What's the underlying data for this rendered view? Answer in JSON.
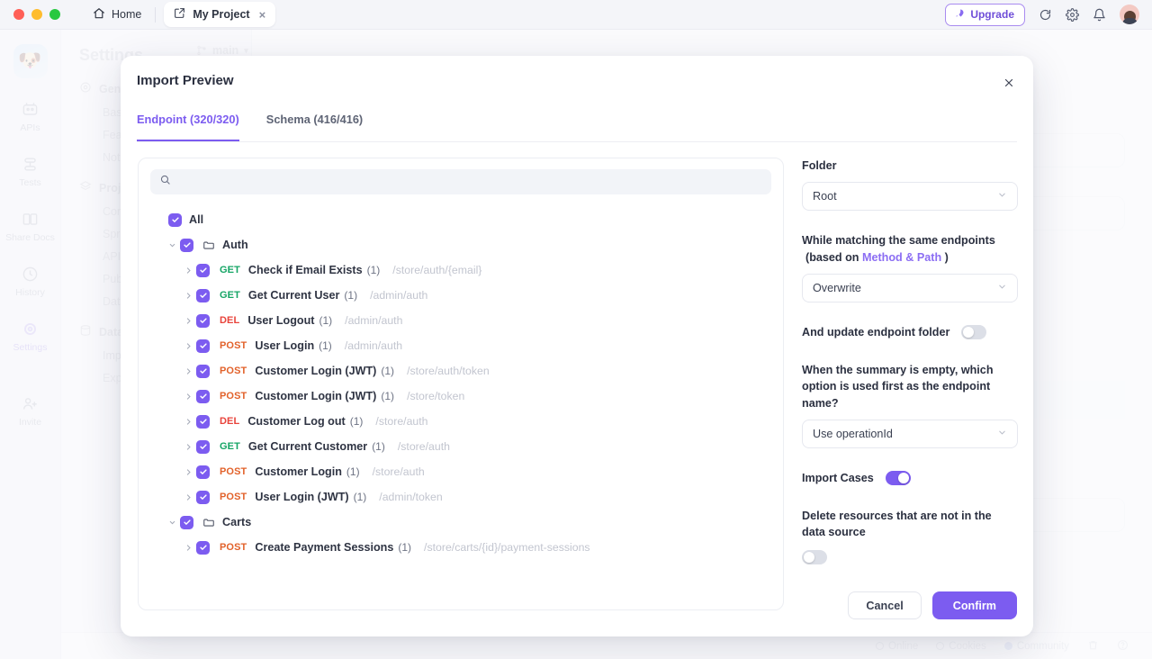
{
  "titlebar": {
    "home_label": "Home",
    "project_tab_label": "My Project",
    "close_tab": "×",
    "upgrade_label": "Upgrade",
    "upgrade_icon": "rocket-icon",
    "refresh_icon": "refresh-icon",
    "settings_icon": "gear-icon",
    "notifications_icon": "bell-icon",
    "avatar_icon": "user-avatar"
  },
  "rail": {
    "logo_glyph": "🐶",
    "items": [
      {
        "label": "APIs",
        "icon": "apis-icon",
        "active": false
      },
      {
        "label": "Tests",
        "icon": "tests-icon",
        "active": false
      },
      {
        "label": "Share Docs",
        "icon": "share-docs-icon",
        "active": false
      },
      {
        "label": "History",
        "icon": "history-clock-icon",
        "active": false
      },
      {
        "label": "Settings",
        "icon": "settings-gear-icon",
        "active": true
      },
      {
        "label": "Invite",
        "icon": "invite-user-icon",
        "active": false
      }
    ]
  },
  "background": {
    "settings_title": "Settings",
    "branch_label": "main",
    "groups": [
      {
        "label": "General",
        "icon": "gear-icon",
        "children": [
          "Basic",
          "Feature",
          "Notification"
        ]
      },
      {
        "label": "Project",
        "icon": "stack-icon",
        "children": [
          "Common",
          "Sprint",
          "API Version",
          "Publish",
          "Database"
        ]
      },
      {
        "label": "Data",
        "icon": "database-icon",
        "children": [
          "Import",
          "Export"
        ]
      }
    ],
    "status": [
      {
        "label": "Online",
        "icon": "status-dot"
      },
      {
        "label": "Cookies",
        "icon": "cookies-dot"
      },
      {
        "label": "Community",
        "icon": "community-dot"
      }
    ],
    "status_icons": [
      "trash-icon",
      "help-icon"
    ]
  },
  "modal": {
    "title": "Import Preview",
    "close_icon": "close-icon",
    "tabs": [
      {
        "label": "Endpoint (320/320)",
        "active": true
      },
      {
        "label": "Schema (416/416)",
        "active": false
      }
    ],
    "search_placeholder": "",
    "search_value": "",
    "search_icon": "search-icon",
    "tree": {
      "all_label": "All",
      "folders": [
        {
          "name": "Auth",
          "checked": true,
          "expanded": true,
          "endpoints": [
            {
              "method": "GET",
              "name": "Check if Email Exists",
              "count": "(1)",
              "path": "/store/auth/{email}"
            },
            {
              "method": "GET",
              "name": "Get Current User",
              "count": "(1)",
              "path": "/admin/auth"
            },
            {
              "method": "DEL",
              "name": "User Logout",
              "count": "(1)",
              "path": "/admin/auth"
            },
            {
              "method": "POST",
              "name": "User Login",
              "count": "(1)",
              "path": "/admin/auth"
            },
            {
              "method": "POST",
              "name": "Customer Login (JWT)",
              "count": "(1)",
              "path": "/store/auth/token"
            },
            {
              "method": "POST",
              "name": "Customer Login (JWT)",
              "count": "(1)",
              "path": "/store/token"
            },
            {
              "method": "DEL",
              "name": "Customer Log out",
              "count": "(1)",
              "path": "/store/auth"
            },
            {
              "method": "GET",
              "name": "Get Current Customer",
              "count": "(1)",
              "path": "/store/auth"
            },
            {
              "method": "POST",
              "name": "Customer Login",
              "count": "(1)",
              "path": "/store/auth"
            },
            {
              "method": "POST",
              "name": "User Login (JWT)",
              "count": "(1)",
              "path": "/admin/token"
            }
          ]
        },
        {
          "name": "Carts",
          "checked": true,
          "expanded": true,
          "endpoints": [
            {
              "method": "POST",
              "name": "Create Payment Sessions",
              "count": "(1)",
              "path": "/store/carts/{id}/payment-sessions"
            }
          ]
        }
      ]
    },
    "options": {
      "folder_label": "Folder",
      "folder_value": "Root",
      "match_label_line1": "While matching the same endpoints",
      "match_label_line2_pre": "(based on",
      "match_label_link": "Method & Path",
      "match_label_line2_post": ")",
      "match_value": "Overwrite",
      "update_folder_label": "And update endpoint folder",
      "update_folder_on": false,
      "summary_label": "When the summary is empty, which option is used first as the endpoint name?",
      "summary_value": "Use operationId",
      "import_cases_label": "Import Cases",
      "import_cases_on": true,
      "delete_resources_label": "Delete resources that are not in the data source",
      "delete_resources_on": false
    },
    "cancel_label": "Cancel",
    "confirm_label": "Confirm",
    "accent_color": "#7c5cf0"
  }
}
